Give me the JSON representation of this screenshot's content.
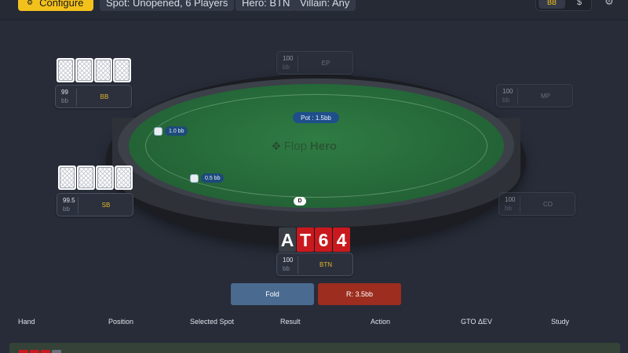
{
  "toolbar": {
    "configure_label": "Configure",
    "configure_icon": "sliders-icon",
    "chips": [
      "Spot: Unopened, 6 Players",
      "Hero: BTN",
      "Villain: Any"
    ],
    "unit_toggle": {
      "bb_label": "BB",
      "dollar_label": "$",
      "selected": "BB"
    },
    "settings_icon": "gear-icon"
  },
  "table": {
    "pot_label": "Pot : 1.5bb",
    "logo": {
      "part1": "Flop",
      "part2": "Hero"
    },
    "bets": [
      {
        "position": "BB",
        "label": "1.0 bb"
      },
      {
        "position": "SB",
        "label": "0.5 bb"
      }
    ],
    "dealer_button": "D"
  },
  "seats": {
    "ep": {
      "stack": "100",
      "unit": "bb",
      "position": "EP"
    },
    "mp": {
      "stack": "100",
      "unit": "bb",
      "position": "MP"
    },
    "co": {
      "stack": "100",
      "unit": "bb",
      "position": "CO"
    },
    "btn": {
      "stack": "100",
      "unit": "bb",
      "position": "BTN"
    },
    "sb": {
      "stack": "99.5",
      "unit": "bb",
      "position": "SB"
    },
    "bb": {
      "stack": "99",
      "unit": "bb",
      "position": "BB"
    }
  },
  "hero_hand": {
    "cards": [
      {
        "rank": "A",
        "suit": "spade"
      },
      {
        "rank": "T",
        "suit": "heart"
      },
      {
        "rank": "6",
        "suit": "heart"
      },
      {
        "rank": "4",
        "suit": "heart"
      }
    ]
  },
  "actions": {
    "fold_label": "Fold",
    "raise_label": "R: 3.5bb"
  },
  "history": {
    "columns": [
      "Hand",
      "Position",
      "Selected Spot",
      "Result",
      "Action",
      "GTO ΔEV",
      "Study"
    ]
  },
  "colors": {
    "accent": "#f3c11c",
    "felt": "#236336",
    "fold": "#4a6b8f",
    "raise": "#9c2d1f",
    "heart_card": "#c9191e"
  }
}
